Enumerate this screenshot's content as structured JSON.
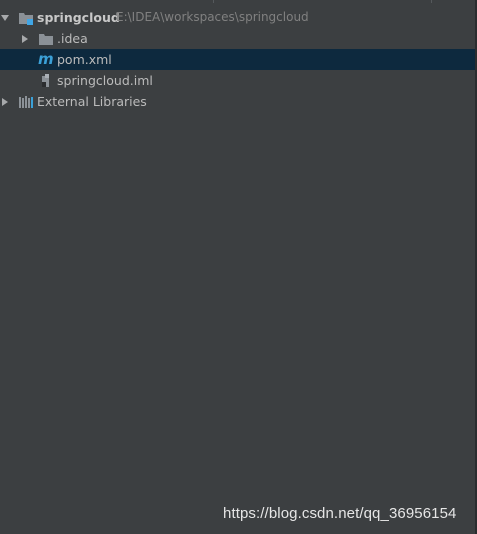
{
  "project_tree": {
    "root": {
      "name": "springcloud",
      "path": "E:\\IDEA\\workspaces\\springcloud",
      "expanded": true,
      "icon": "module-folder-icon"
    },
    "children": [
      {
        "label": ".idea",
        "icon": "folder-icon",
        "expandable": true,
        "expanded": false
      },
      {
        "label": "pom.xml",
        "icon": "maven-icon",
        "selected": true
      },
      {
        "label": "springcloud.iml",
        "icon": "iml-file-icon"
      }
    ],
    "external_libraries": {
      "label": "External Libraries",
      "icon": "libraries-icon",
      "expandable": true,
      "expanded": false
    }
  },
  "watermark": "https://blog.csdn.net/qq_36956154",
  "colors": {
    "background": "#3c3f41",
    "selection": "#0d293e",
    "text": "#bbbbbb",
    "path_text": "#808080",
    "folder": "#8b9197",
    "maven": "#3ba0d7",
    "module_accent": "#40a6e6"
  }
}
